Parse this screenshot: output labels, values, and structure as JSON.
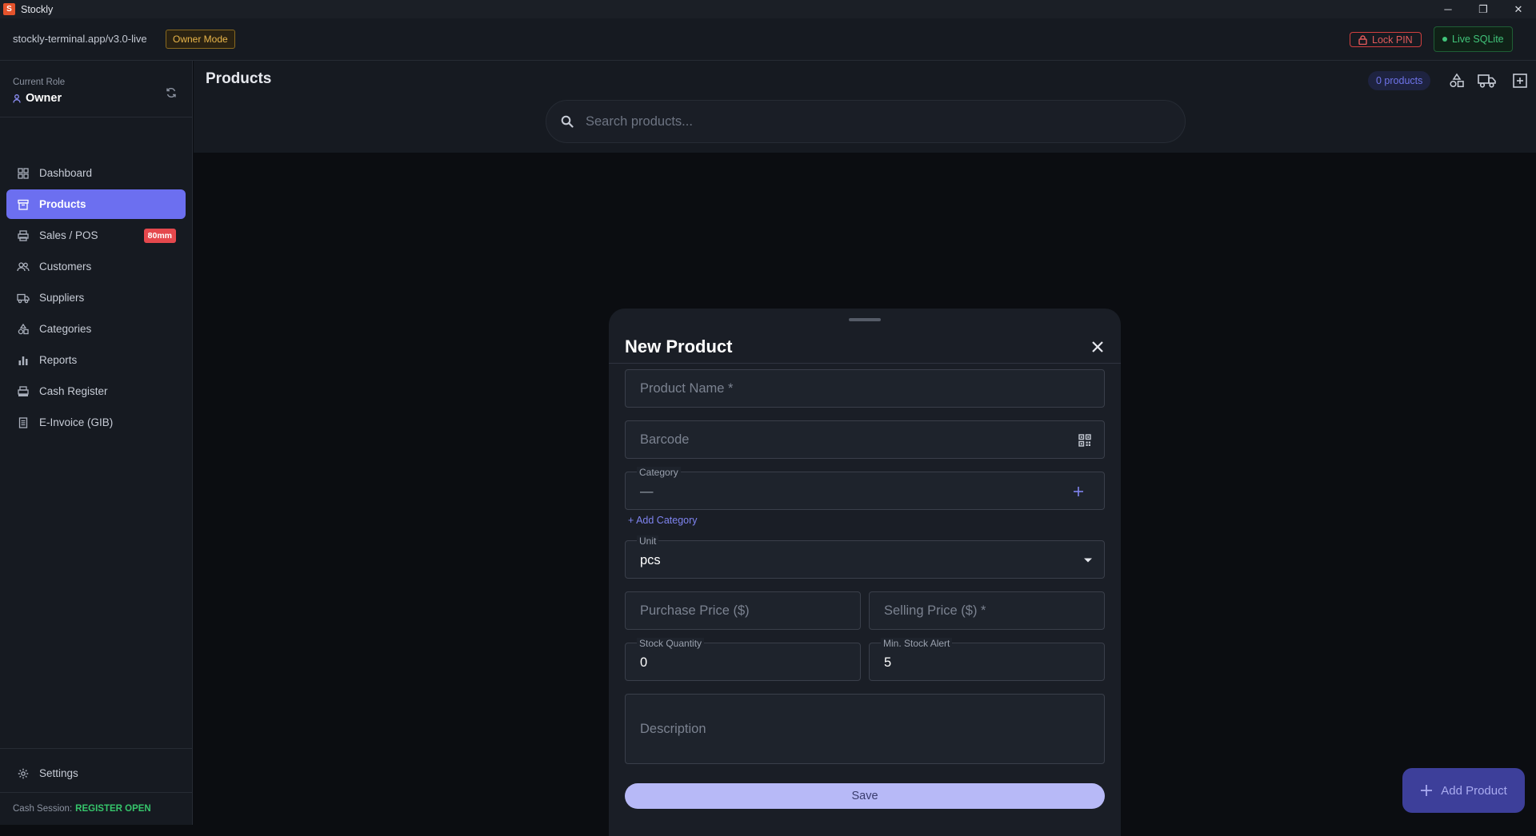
{
  "window": {
    "title": "Stockly",
    "app_icon_letter": "S",
    "controls": {
      "minimize": "─",
      "restore": "❐",
      "close": "✕"
    }
  },
  "topbar": {
    "url": "stockly-terminal.app/v3.0-live",
    "mode_badge": "Owner Mode",
    "lock_pin": "Lock PIN",
    "db_status": "Live SQLite"
  },
  "sidebar": {
    "role_label": "Current Role",
    "role_value": "Owner",
    "items": [
      {
        "label": "Dashboard",
        "icon": "dashboard-icon",
        "active": false
      },
      {
        "label": "Products",
        "icon": "box-icon",
        "active": true
      },
      {
        "label": "Sales / POS",
        "icon": "printer-icon",
        "active": false,
        "badge": "80mm"
      },
      {
        "label": "Customers",
        "icon": "users-icon",
        "active": false
      },
      {
        "label": "Suppliers",
        "icon": "truck-icon",
        "active": false
      },
      {
        "label": "Categories",
        "icon": "shapes-icon",
        "active": false
      },
      {
        "label": "Reports",
        "icon": "bar-chart-icon",
        "active": false
      },
      {
        "label": "Cash Register",
        "icon": "register-icon",
        "active": false
      },
      {
        "label": "E-Invoice (GIB)",
        "icon": "receipt-icon",
        "active": false
      }
    ],
    "settings_label": "Settings",
    "cash_session_label": "Cash Session:",
    "cash_session_status": "REGISTER OPEN"
  },
  "main": {
    "title": "Products",
    "count": "0 products",
    "search_placeholder": "Search products...",
    "fab_label": "Add Product"
  },
  "modal": {
    "title": "New Product",
    "product_name_placeholder": "Product Name *",
    "barcode_placeholder": "Barcode",
    "category_label": "Category",
    "category_value": "—",
    "add_category": "+ Add Category",
    "unit_label": "Unit",
    "unit_value": "pcs",
    "purchase_price_placeholder": "Purchase Price ($)",
    "selling_price_placeholder": "Selling Price ($) *",
    "stock_quantity_label": "Stock Quantity",
    "stock_quantity_value": "0",
    "min_stock_label": "Min. Stock Alert",
    "min_stock_value": "5",
    "description_placeholder": "Description",
    "save_label": "Save"
  },
  "colors": {
    "accent": "#6c6ff0",
    "danger": "#e5484d",
    "success": "#36c56b",
    "warning": "#e9b64b"
  }
}
